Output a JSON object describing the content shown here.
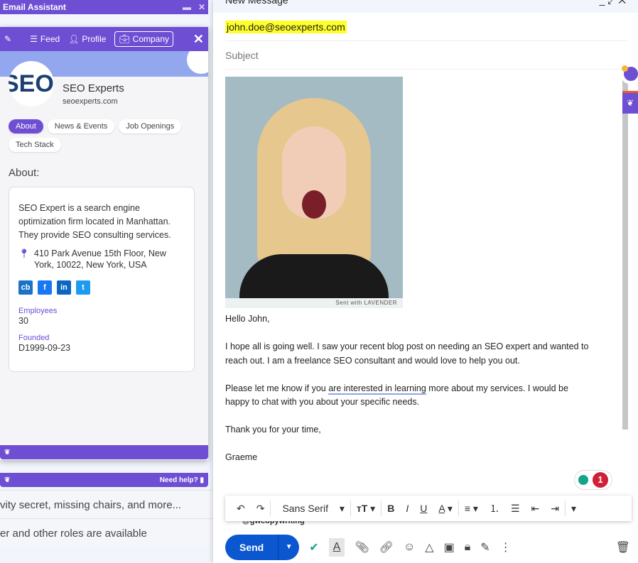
{
  "assistant": {
    "title": "Email Assistant",
    "nav": {
      "feed": "Feed",
      "profile": "Profile",
      "company": "Company"
    },
    "company": {
      "logo_text": "SEO E",
      "name": "SEO Experts",
      "domain": "seoexperts.com"
    },
    "tabs": [
      "About",
      "News & Events",
      "Job Openings",
      "Tech Stack"
    ],
    "about_heading": "About:",
    "description": "SEO Expert is a search engine optimization firm located in Manhattan. They provide SEO consulting services.",
    "address": "410 Park Avenue 15th Floor, New York, 10022, New York, USA",
    "social": [
      "cb",
      "f",
      "in",
      "t"
    ],
    "employees_label": "Employees",
    "employees": "30",
    "founded_label": "Founded",
    "founded": "D1999-09-23",
    "help": "Need help?",
    "accent": "#6e4fd3"
  },
  "inbox_rows": [
    "vity secret, missing chairs, and more...",
    "er and other roles are available"
  ],
  "compose": {
    "title": "New Message",
    "to": "john.doe@seoexperts.com",
    "subject_placeholder": "Subject",
    "image_caption": "Sent with LAVENDER",
    "body": {
      "greeting": "Hello John,",
      "p1": "I hope all is going well. I saw your recent blog post on needing an SEO expert and wanted to reach out. I am a freelance SEO consultant and would love to help you out.",
      "p2a": "Please let me know if you ",
      "p2b": "are interested in learning",
      "p2c": " more about my services. I would be happy to chat with you about your specific needs.",
      "p3": "Thank you for your time,",
      "sign": "Graeme"
    },
    "grammarly_count": "1",
    "signature_handle": "@gwcopywriting",
    "toolbar": {
      "font": "Sans Serif"
    },
    "send": "Send",
    "send_color": "#0b57d0"
  }
}
